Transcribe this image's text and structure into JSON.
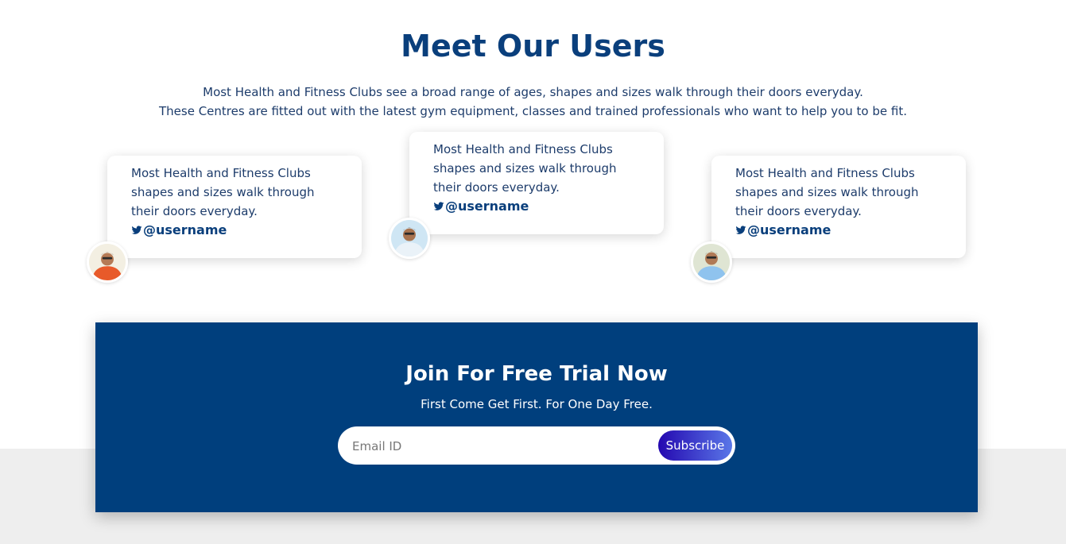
{
  "users_section": {
    "title": "Meet Our Users",
    "intro_line1": "Most Health and Fitness Clubs see a broad range of ages, shapes and sizes walk through their doors everyday.",
    "intro_line2": "These Centres are fitted out with the latest gym equipment, classes and trained professionals who want to help you to be fit.",
    "cards": [
      {
        "quote": "Most Health and Fitness Clubs shapes and sizes walk through their doors everyday.",
        "handle": "@username",
        "icon": "twitter-icon"
      },
      {
        "quote": "Most Health and Fitness Clubs shapes and sizes walk through their doors everyday.",
        "handle": "@username",
        "icon": "twitter-icon"
      },
      {
        "quote": "Most Health and Fitness Clubs shapes and sizes walk through their doors everyday.",
        "handle": "@username",
        "icon": "twitter-icon"
      }
    ]
  },
  "trial_section": {
    "title": "Join For Free Trial Now",
    "subtitle": "First Come Get First. For One Day Free.",
    "email_placeholder": "Email ID",
    "subscribe_label": "Subscribe"
  },
  "colors": {
    "heading": "#0a3f7c",
    "body_text": "#1d3c6b",
    "trial_background": "#003f7d",
    "button_gradient_start": "#2408b0",
    "button_gradient_end": "#5a77e8",
    "bottom_band": "#eeeeee"
  }
}
